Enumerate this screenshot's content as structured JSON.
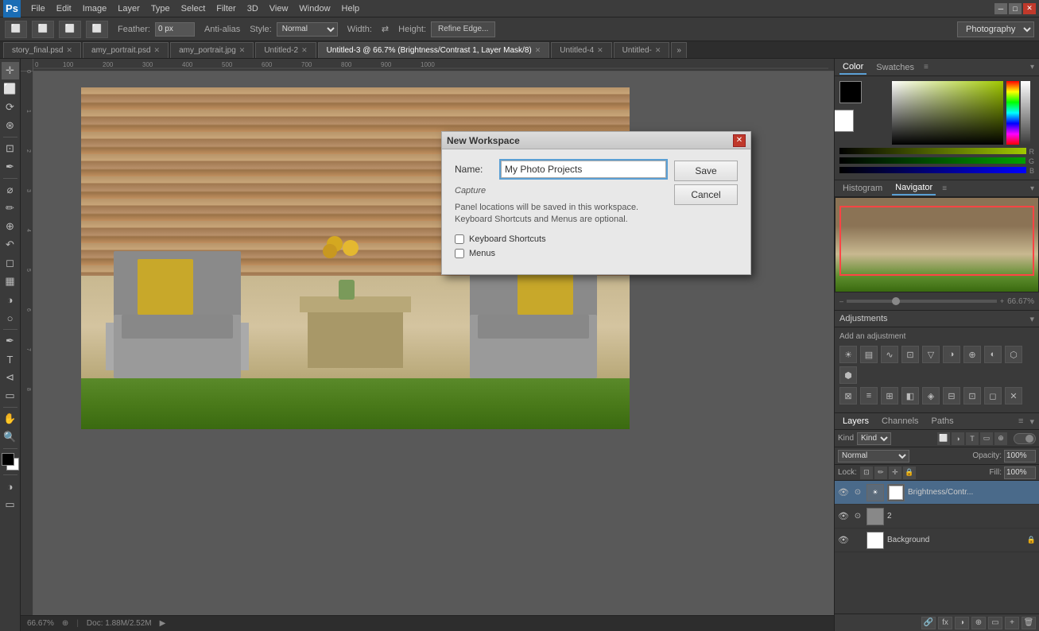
{
  "app": {
    "name": "Adobe Photoshop",
    "icon_label": "Ps"
  },
  "menu": {
    "items": [
      "File",
      "Edit",
      "Image",
      "Layer",
      "Type",
      "Select",
      "Filter",
      "3D",
      "View",
      "Window",
      "Help"
    ]
  },
  "window_controls": {
    "minimize": "─",
    "maximize": "□",
    "close": "✕"
  },
  "toolbar": {
    "feather_label": "Feather:",
    "feather_value": "0 px",
    "anti_alias_label": "Anti-alias",
    "style_label": "Style:",
    "style_value": "Normal",
    "width_label": "Width:",
    "height_label": "Height:",
    "refine_edge_label": "Refine Edge...",
    "workspace_label": "Photography"
  },
  "tabs": [
    {
      "label": "story_final.psd",
      "active": false
    },
    {
      "label": "amy_portrait.psd",
      "active": false
    },
    {
      "label": "amy_portrait.jpg",
      "active": false
    },
    {
      "label": "Untitled-2",
      "active": false
    },
    {
      "label": "Untitled-3 @ 66.7% (Brightness/Contrast 1, Layer Mask/8)",
      "active": true
    },
    {
      "label": "Untitled-4",
      "active": false
    },
    {
      "label": "Untitled-",
      "active": false
    }
  ],
  "panels": {
    "color_tab": "Color",
    "swatches_tab": "Swatches",
    "histogram_tab": "Histogram",
    "navigator_tab": "Navigator",
    "adjustments_title": "Adjustments",
    "adjustments_subtitle": "Add an adjustment",
    "layers_tab": "Layers",
    "channels_tab": "Channels",
    "paths_tab": "Paths"
  },
  "layers": {
    "filter_label": "Kind",
    "blend_mode": "Normal",
    "opacity_label": "Opacity:",
    "opacity_value": "100%",
    "lock_label": "Lock:",
    "fill_label": "Fill:",
    "fill_value": "100%",
    "items": [
      {
        "name": "Brightness/Contr...",
        "type": "adjustment",
        "active": true,
        "has_mask": true
      },
      {
        "name": "2",
        "type": "layer",
        "active": false,
        "has_mask": false
      },
      {
        "name": "Background",
        "type": "background",
        "active": false,
        "locked": true
      }
    ]
  },
  "dialog": {
    "title": "New Workspace",
    "name_label": "Name:",
    "name_value": "My Photo Projects",
    "capture_section": "Capture",
    "description": "Panel locations will be saved in this workspace.\nKeyboard Shortcuts and Menus are optional.",
    "keyboard_shortcuts_label": "Keyboard Shortcuts",
    "menus_label": "Menus",
    "save_label": "Save",
    "cancel_label": "Cancel"
  },
  "status_bar": {
    "zoom": "66.67%",
    "doc_size": "Doc: 1.88M/2.52M"
  },
  "navigator": {
    "zoom_value": "66.67%"
  }
}
